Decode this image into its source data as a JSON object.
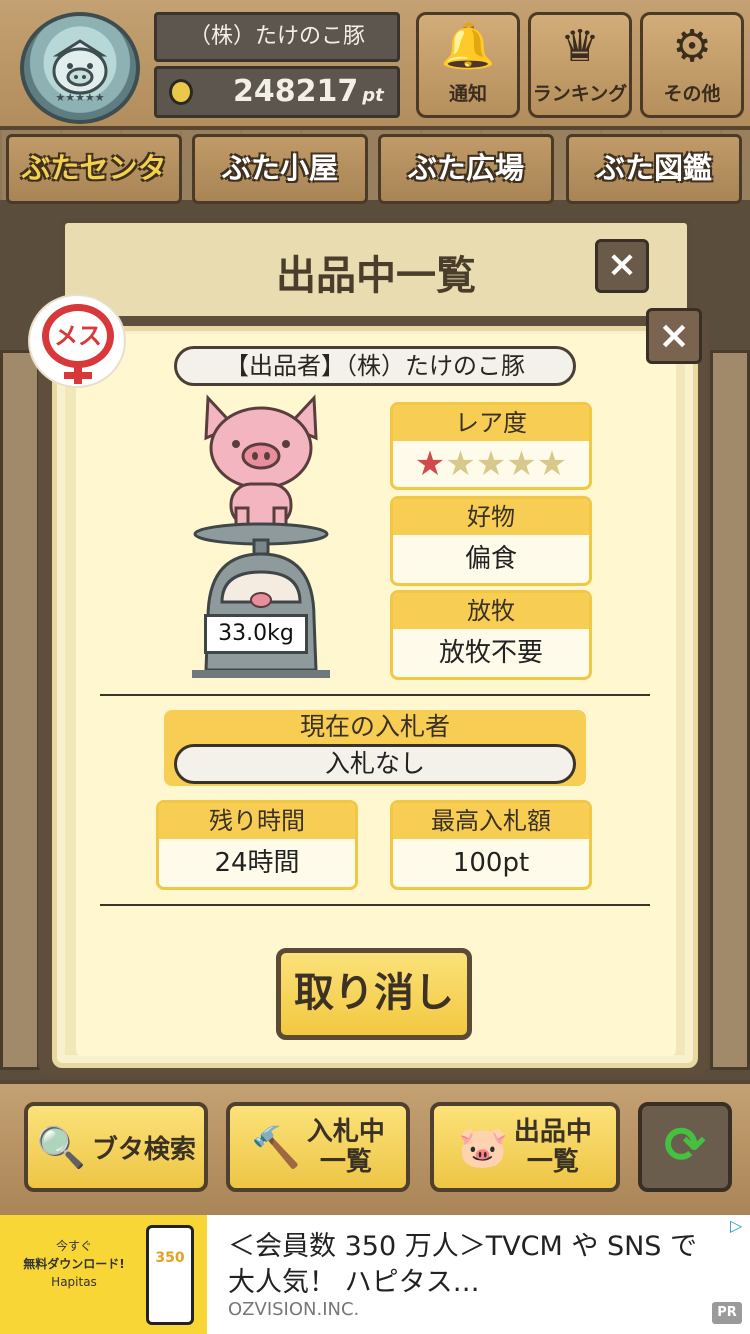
{
  "header": {
    "user_name": "（株）たけのこ豚",
    "points": "248217",
    "points_unit": "pt",
    "buttons": [
      {
        "label": "通知",
        "icon": "bell-icon"
      },
      {
        "label": "ランキング",
        "icon": "crown-icon"
      },
      {
        "label": "その他",
        "icon": "gear-icon"
      }
    ]
  },
  "tabs": [
    {
      "label": "ぶたセンター",
      "active": true
    },
    {
      "label": "ぶた小屋",
      "active": false
    },
    {
      "label": "ぶた広場",
      "active": false
    },
    {
      "label": "ぶた図鑑",
      "active": false
    }
  ],
  "panel": {
    "title": "出品中一覧",
    "close": "×"
  },
  "detail": {
    "gender_badge": "メス",
    "seller": "【出品者】（株）たけのこ豚",
    "weight": "33.0kg",
    "rarity": {
      "label": "レア度",
      "stars_on": 1,
      "stars_total": 5,
      "star_on_color": "#d04a4a",
      "star_off_color": "#d8c98a"
    },
    "favorite": {
      "label": "好物",
      "value": "偏食"
    },
    "grazing": {
      "label": "放牧",
      "value": "放牧不要"
    },
    "current_bidder": {
      "label": "現在の入札者",
      "value": "入札なし"
    },
    "remaining_time": {
      "label": "残り時間",
      "value": "24時間"
    },
    "highest_bid": {
      "label": "最高入札額",
      "value": "100pt"
    },
    "cancel_label": "取り消し",
    "close": "×"
  },
  "bottom_bar": {
    "search": {
      "label": "ブタ検索",
      "icon": "magnifier-icon"
    },
    "bidding": {
      "label1": "入札中",
      "label2": "一覧",
      "icon": "gavel-icon"
    },
    "listing": {
      "label1": "出品中",
      "label2": "一覧",
      "icon": "pig-icon"
    },
    "refresh": {
      "icon": "refresh-icon"
    }
  },
  "ad": {
    "image_text1": "今すぐ",
    "image_text2": "無料ダウンロード!",
    "image_text3": "Hapitas",
    "image_number": "350",
    "title": "＜会員数 350 万人＞TVCM や SNS で大人気！ ハピタス…",
    "advertiser": "OZVISION.INC.",
    "pr_label": "PR"
  },
  "colors": {
    "accent_yellow": "#f7cd54",
    "female_red": "#d9383b",
    "refresh_green": "#46c040"
  }
}
